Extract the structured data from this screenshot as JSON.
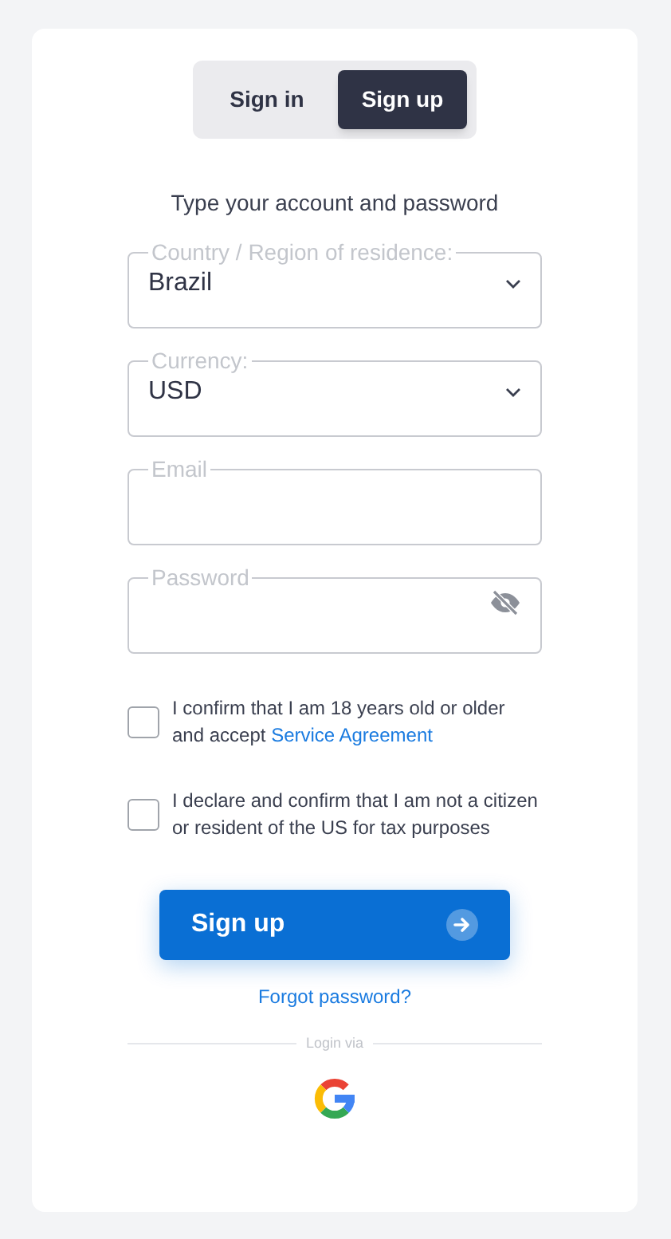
{
  "tabs": [
    {
      "label": "Sign in",
      "selected": false
    },
    {
      "label": "Sign up",
      "selected": true
    }
  ],
  "subtitle": "Type your account and password",
  "fields": [
    {
      "kind": "select",
      "label": "Country / Region of residence:",
      "value": "Brazil"
    },
    {
      "kind": "select",
      "label": "Currency:",
      "value": "USD"
    },
    {
      "kind": "text",
      "label": "Email"
    },
    {
      "kind": "password",
      "label": "Password"
    }
  ],
  "agreements": [
    {
      "text": "I confirm that I am 18 years old or older and accept",
      "link": "Service Agreement",
      "checked": false
    },
    {
      "text": "I declare and confirm that I am not a citizen or resident of the US for tax purposes",
      "checked": false
    }
  ],
  "submit_button": "Sign up",
  "forgot_link": "Forgot password?",
  "divider_label": "Login via"
}
